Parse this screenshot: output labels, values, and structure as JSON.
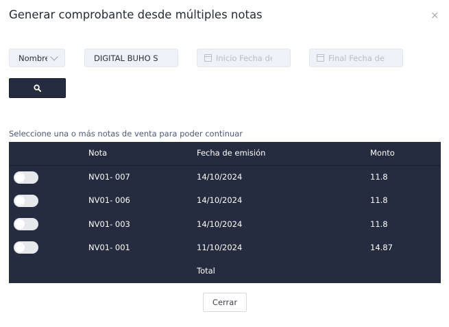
{
  "modal": {
    "title": "Generar comprobante desde múltiples notas",
    "close_glyph": "×"
  },
  "filters": {
    "field_selector": "Nombre",
    "client_value": "DIGITAL BUHO S.A.C.",
    "start_date_placeholder": "Inicio Fecha de emisión",
    "end_date_placeholder": "Final Fecha de emisión",
    "search_icon": "search-icon"
  },
  "hint": "Seleccione una o más notas de venta para poder continuar",
  "table": {
    "columns": [
      "Nota",
      "Fecha de emisión",
      "Monto"
    ],
    "rows": [
      {
        "selected": false,
        "nota": "NV01- 007",
        "fecha": "14/10/2024",
        "monto": "11.8"
      },
      {
        "selected": false,
        "nota": "NV01- 006",
        "fecha": "14/10/2024",
        "monto": "11.8"
      },
      {
        "selected": false,
        "nota": "NV01- 003",
        "fecha": "14/10/2024",
        "monto": "11.8"
      },
      {
        "selected": false,
        "nota": "NV01- 001",
        "fecha": "11/10/2024",
        "monto": "14.87"
      }
    ],
    "total_label": "Total"
  },
  "footer": {
    "close_label": "Cerrar"
  },
  "colors": {
    "header_bg": "#262c40",
    "search_button": "#262c3f",
    "hint_text": "#4a5a78"
  }
}
